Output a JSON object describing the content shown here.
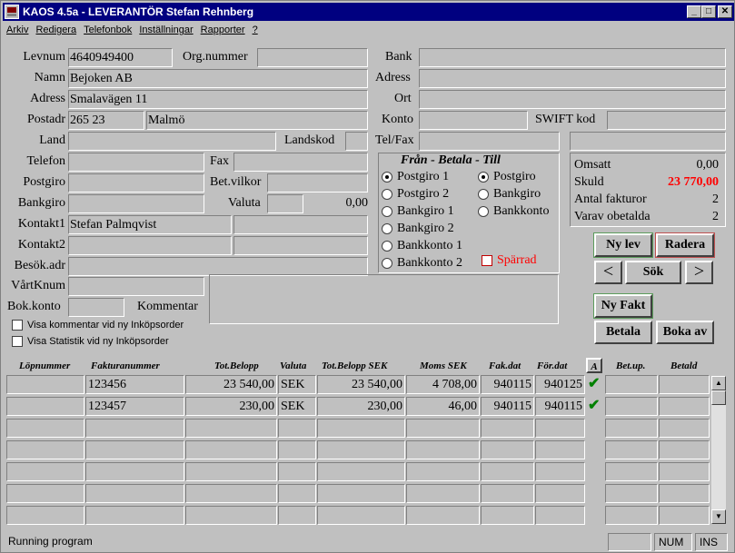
{
  "title": "KAOS 4.5a - LEVERANTÖR  Stefan Rehnberg",
  "window_buttons": {
    "min": "_",
    "max": "□",
    "close": "✕"
  },
  "menu": [
    "Arkiv",
    "Redigera",
    "Telefonbok",
    "Inställningar",
    "Rapporter",
    "?"
  ],
  "labels": {
    "levnum": "Levnum",
    "orgnr": "Org.nummer",
    "namn": "Namn",
    "adress": "Adress",
    "postadr": "Postadr",
    "land": "Land",
    "landskod": "Landskod",
    "telefon": "Telefon",
    "fax": "Fax",
    "postgiro": "Postgiro",
    "betvilkor": "Bet.vilkor",
    "bankgiro": "Bankgiro",
    "valuta": "Valuta",
    "kontakt1": "Kontakt1",
    "kontakt2": "Kontakt2",
    "besok": "Besök.adr",
    "vartknum": "VårtKnum",
    "bokkonto": "Bok.konto",
    "kommentar": "Kommentar",
    "bank": "Bank",
    "adress2": "Adress",
    "ort": "Ort",
    "konto": "Konto",
    "swift": "SWIFT kod",
    "telfax": "Tel/Fax"
  },
  "values": {
    "levnum": "4640949400",
    "namn": "Bejoken AB",
    "adress": "Smalavägen 11",
    "postnr": "265 23",
    "ort": "Malmö",
    "valuta_amount": "0,00",
    "kontakt1": "Stefan Palmqvist"
  },
  "payment": {
    "heading": "Från -  Betala  - Till",
    "from": [
      "Postgiro 1",
      "Postgiro 2",
      "Bankgiro 1",
      "Bankgiro 2",
      "Bankkonto 1",
      "Bankkonto 2"
    ],
    "to": [
      "Postgiro",
      "Bankgiro",
      "Bankkonto"
    ],
    "sparrad": "Spärrad"
  },
  "checkboxes": {
    "kommentar": "Visa kommentar vid ny Inköpsorder",
    "statistik": "Visa Statistik vid ny Inköpsorder"
  },
  "summary": {
    "omsatt_label": "Omsatt",
    "omsatt": "0,00",
    "skuld_label": "Skuld",
    "skuld": "23 770,00",
    "antal_label": "Antal fakturor",
    "antal": "2",
    "obetalda_label": "Varav obetalda",
    "obetalda": "2"
  },
  "buttons": {
    "ny_lev": "Ny lev",
    "radera": "Radera",
    "prev": "<",
    "sok": "Sök",
    "next": ">",
    "ny_fakt": "Ny Fakt",
    "betala": "Betala",
    "boka_av": "Boka av"
  },
  "table": {
    "headers": [
      "Löpnummer",
      "Fakturanummer",
      "Tot.Belopp",
      "Valuta",
      "Tot.Belopp SEK",
      "Moms SEK",
      "Fak.dat",
      "För.dat",
      "A",
      "Bet.up.",
      "Betald"
    ],
    "rows": [
      [
        "",
        "123456",
        "23 540,00",
        "SEK",
        "23 540,00",
        "4 708,00",
        "940115",
        "940125",
        "✔",
        "",
        ""
      ],
      [
        "",
        "123457",
        "230,00",
        "SEK",
        "230,00",
        "46,00",
        "940115",
        "940115",
        "✔",
        "",
        ""
      ]
    ]
  },
  "status": {
    "text": "Running program",
    "num": "NUM",
    "ins": "INS"
  },
  "colors": {
    "skuld": "#ff0000",
    "sparrad": "#ff0000",
    "check": "#008000",
    "titlebar": "#000080"
  }
}
